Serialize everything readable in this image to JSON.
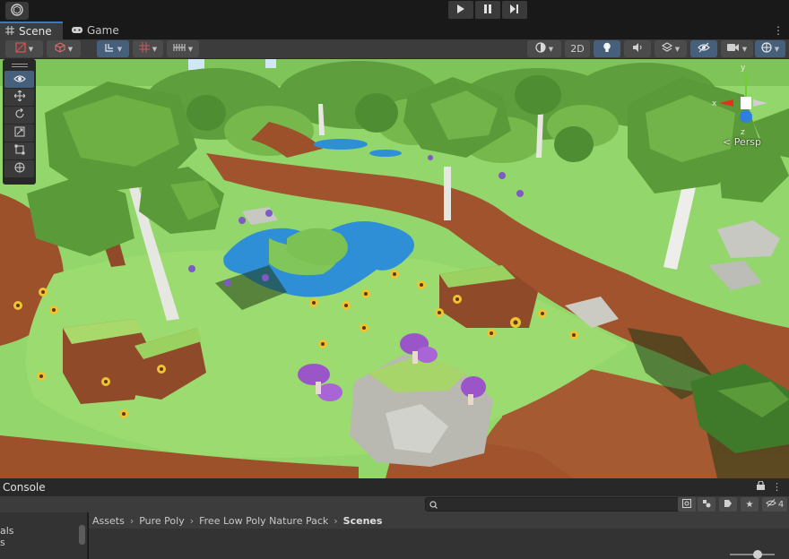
{
  "toolbar": {
    "account_icon": "unity-logo-icon",
    "play_controls": [
      "play-icon",
      "pause-icon",
      "step-icon"
    ]
  },
  "tabs": [
    {
      "label": "Scene",
      "icon": "hash-grid-icon",
      "active": true
    },
    {
      "label": "Game",
      "icon": "gamepad-icon",
      "active": false
    }
  ],
  "scene_toolbar": {
    "draw_mode_icon": "shaded-mode-icon",
    "render_icon": "cube-icon",
    "transform_icon": "transform-tool-icon",
    "grid_icon": "grid-icon",
    "snap_icon": "snap-icon",
    "shading_icon": "shading-icon",
    "mode_2d_label": "2D",
    "lighting_icon": "light-bulb-icon",
    "audio_icon": "audio-icon",
    "effects_icon": "effects-icon",
    "visibility_icon": "hidden-eye-icon",
    "camera_icon": "camera-icon",
    "gizmos_icon": "gizmos-icon"
  },
  "tools": [
    {
      "icon": "eye-icon",
      "active": true
    },
    {
      "icon": "move-icon",
      "active": false
    },
    {
      "icon": "rotate-icon",
      "active": false
    },
    {
      "icon": "scale-icon",
      "active": false
    },
    {
      "icon": "rect-icon",
      "active": false
    },
    {
      "icon": "transform-icon",
      "active": false
    }
  ],
  "gizmo": {
    "axes": [
      "y",
      "x",
      "z"
    ],
    "projection_label": "< Persp"
  },
  "console": {
    "tab_label": "Console",
    "search_placeholder": "",
    "hidden_count": "4",
    "lock_icon": "lock-icon"
  },
  "left_pane": {
    "items": [
      "als",
      "s"
    ]
  },
  "breadcrumbs": [
    "Assets",
    "Pure Poly",
    "Free Low Poly Nature Pack",
    "Scenes"
  ],
  "colors": {
    "accent": "#3a79bb",
    "grass": "#8fd96a",
    "water": "#2f8fd6",
    "path": "#a0532d"
  }
}
